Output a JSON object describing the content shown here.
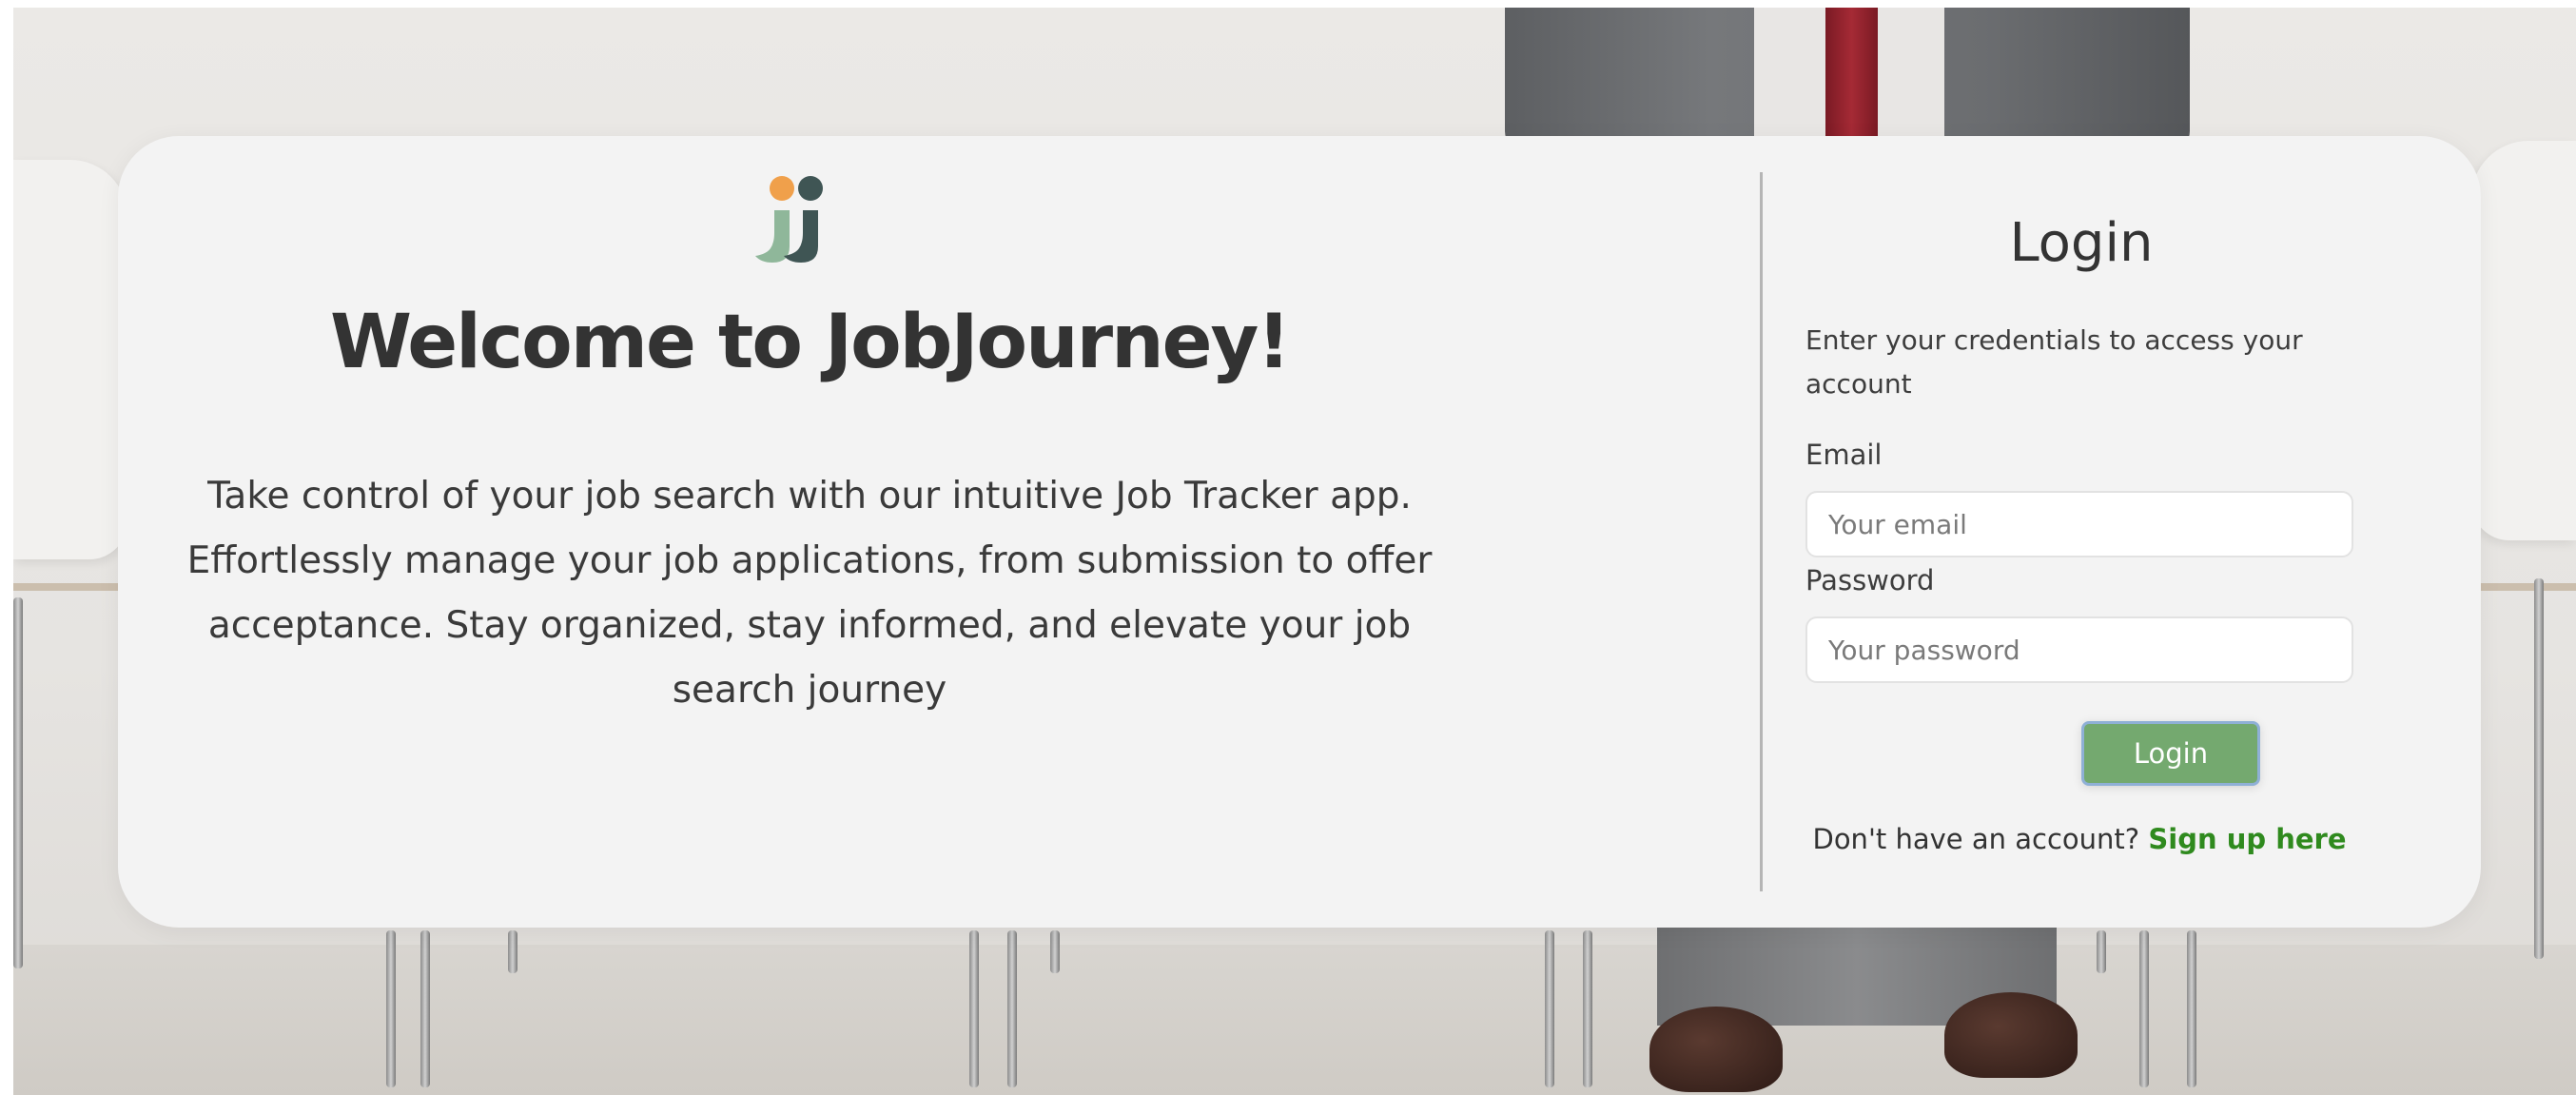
{
  "welcome": {
    "title": "Welcome to JobJourney!",
    "description": "Take control of your job search with our intuitive Job Tracker app. Effortlessly manage your job applications, from submission to offer acceptance. Stay organized, stay informed, and elevate your job search journey"
  },
  "login": {
    "title": "Login",
    "description": "Enter your credentials to access your account",
    "email": {
      "label": "Email",
      "placeholder": "Your email",
      "value": ""
    },
    "password": {
      "label": "Password",
      "placeholder": "Your password",
      "value": ""
    },
    "submit_label": "Login",
    "signup_prompt": "Don't have an account?",
    "signup_link": "Sign up here"
  },
  "icons": {
    "logo": "jobjourney-logo"
  },
  "colors": {
    "card_background": "#f3f3f3",
    "button": "#74a96f",
    "button_border": "#8fb0d6",
    "link": "#2f8a1e",
    "logo_orange": "#f0a04b",
    "logo_dark": "#3f5554",
    "logo_green": "#8fb79a"
  }
}
